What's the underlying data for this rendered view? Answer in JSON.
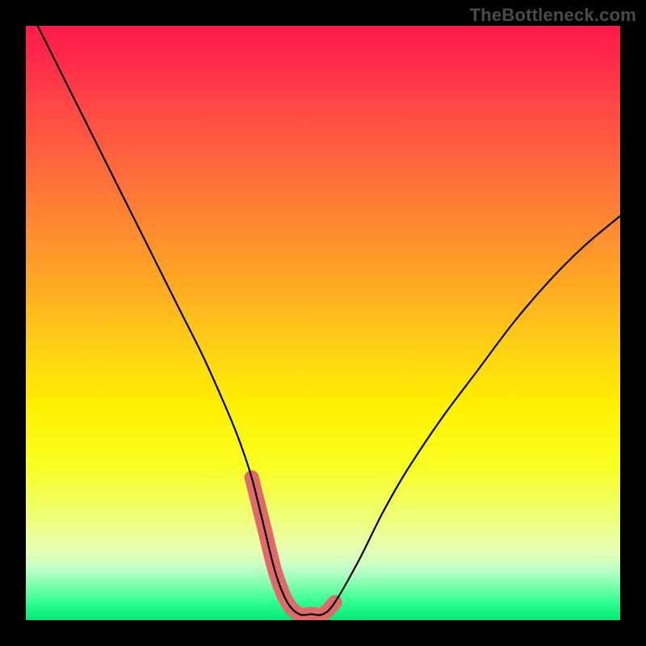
{
  "watermark": "TheBottleneck.com",
  "chart_data": {
    "type": "line",
    "title": "",
    "xlabel": "",
    "ylabel": "",
    "xlim": [
      0,
      100
    ],
    "ylim": [
      0,
      100
    ],
    "x": [
      2,
      6,
      10,
      14,
      18,
      22,
      26,
      30,
      34,
      36,
      38,
      40,
      42,
      44,
      46,
      48,
      50,
      52,
      56,
      60,
      64,
      70,
      76,
      82,
      88,
      94,
      100
    ],
    "values": [
      100,
      92,
      84,
      76,
      68,
      60,
      52,
      44,
      35,
      30,
      24,
      16,
      8,
      3,
      1,
      1,
      1,
      3,
      10,
      18,
      25,
      34,
      42,
      50,
      57,
      63,
      68
    ],
    "highlight_region": {
      "x0": 38,
      "x1": 52,
      "y0": 0,
      "y1": 10
    },
    "gradient_colors": {
      "top": "#ff1a4a",
      "mid": "#fff000",
      "bottom": "#00e878"
    }
  }
}
